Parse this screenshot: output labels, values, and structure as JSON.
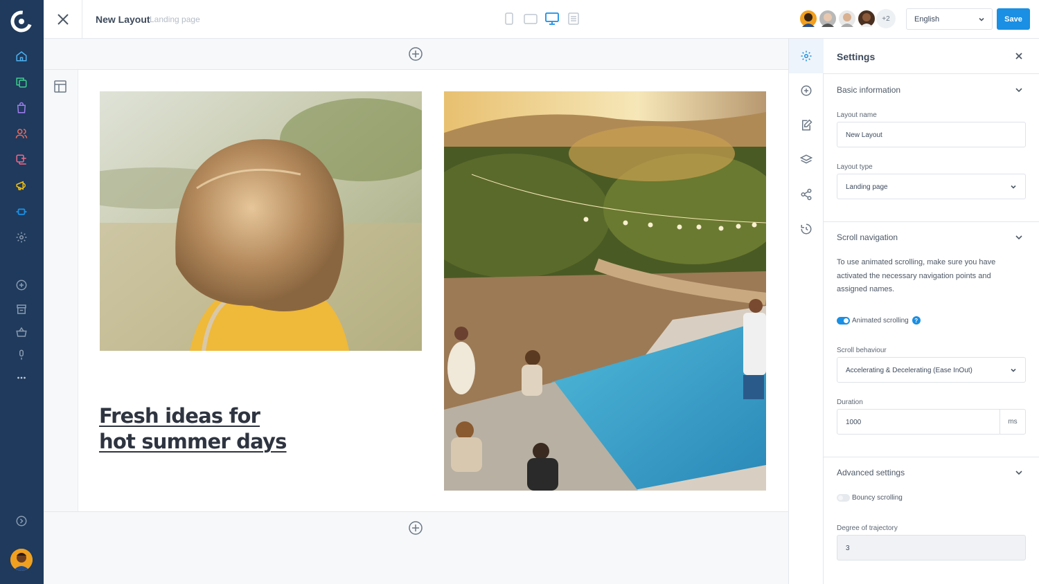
{
  "topbar": {
    "title": "New Layout",
    "subtitle": "Landing page",
    "collaborators_more": "+2",
    "language": "English",
    "save_label": "Save"
  },
  "canvas": {
    "headline_line1": "Fresh ideas for",
    "headline_line2": "hot summer days"
  },
  "settings": {
    "title": "Settings",
    "basic": {
      "heading": "Basic information",
      "layout_name_label": "Layout name",
      "layout_name_value": "New Layout",
      "layout_type_label": "Layout type",
      "layout_type_value": "Landing page"
    },
    "scroll": {
      "heading": "Scroll navigation",
      "description": "To use animated scrolling, make sure you have activated the necessary navigation points and assigned names.",
      "animated_label": "Animated scrolling",
      "animated_on": true,
      "help_glyph": "?",
      "behaviour_label": "Scroll behaviour",
      "behaviour_value": "Accelerating & Decelerating (Ease InOut)",
      "duration_label": "Duration",
      "duration_value": "1000",
      "duration_unit": "ms"
    },
    "advanced": {
      "heading": "Advanced settings",
      "bouncy_label": "Bouncy scrolling",
      "bouncy_on": false,
      "trajectory_label": "Degree of trajectory",
      "trajectory_value": "3"
    }
  },
  "colors": {
    "nav_bg": "#1f3a5c",
    "accent": "#1a8fe3",
    "megaphone": "#f2c315",
    "users": "#ef6a5a",
    "flow": "#1a8fe3"
  }
}
